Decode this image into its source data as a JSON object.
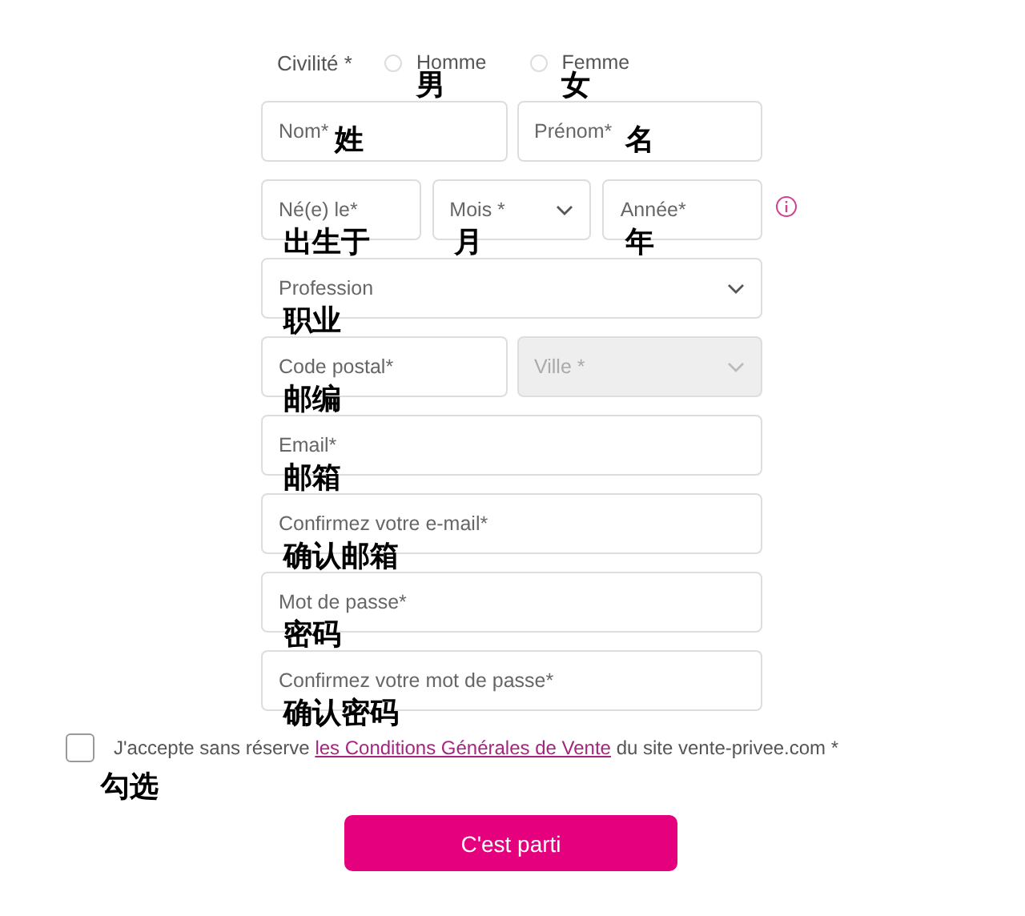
{
  "civility": {
    "label": "Civilité *",
    "options": [
      {
        "label": "Homme",
        "note": "男",
        "selected": false
      },
      {
        "label": "Femme",
        "note": "女",
        "selected": false
      }
    ]
  },
  "rows": [
    {
      "fields": [
        {
          "kind": "text",
          "placeholder": "Nom*",
          "note": "姓"
        },
        {
          "kind": "text",
          "placeholder": "Prénom*",
          "note": "名"
        }
      ]
    },
    {
      "fields": [
        {
          "kind": "text",
          "placeholder": "Né(e) le*",
          "note": "出生于"
        },
        {
          "kind": "select",
          "placeholder": "Mois *",
          "note": "月"
        },
        {
          "kind": "text",
          "placeholder": "Année*",
          "note": "年"
        }
      ],
      "info": true
    },
    {
      "fields": [
        {
          "kind": "select",
          "placeholder": "Profession",
          "note": "职业"
        }
      ]
    },
    {
      "fields": [
        {
          "kind": "text",
          "placeholder": "Code postal*",
          "note": "邮编"
        },
        {
          "kind": "select",
          "placeholder": "Ville *",
          "disabled": true
        }
      ]
    },
    {
      "fields": [
        {
          "kind": "text",
          "placeholder": "Email*",
          "note": "邮箱"
        }
      ]
    },
    {
      "fields": [
        {
          "kind": "text",
          "placeholder": "Confirmez votre e-mail*",
          "note": "确认邮箱"
        }
      ]
    },
    {
      "fields": [
        {
          "kind": "text",
          "placeholder": "Mot de passe*",
          "note": "密码"
        }
      ]
    },
    {
      "fields": [
        {
          "kind": "text",
          "placeholder": "Confirmez votre mot de passe*",
          "note": "确认密码"
        }
      ]
    }
  ],
  "terms": {
    "checked": false,
    "before": "J'accepte sans réserve",
    "link": "les Conditions Générales de Vente",
    "after": "du site vente-privee.com *",
    "note": "勾选"
  },
  "submit": "C'est parti"
}
